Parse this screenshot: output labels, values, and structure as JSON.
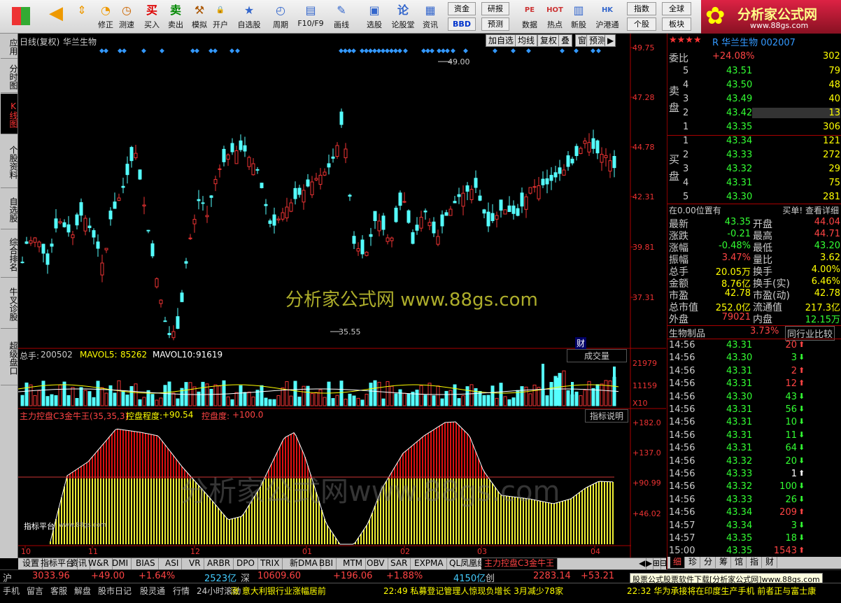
{
  "toolbar": {
    "buttons": [
      "修正",
      "测速",
      "买入",
      "卖出",
      "模拟",
      "开户",
      "自选股",
      "周期",
      "F10/F9",
      "画线",
      "选股",
      "论股堂",
      "资讯",
      "数据",
      "热点",
      "新股",
      "沪港通"
    ],
    "right1": [
      "资金",
      "研报",
      "指数",
      "全球"
    ],
    "right2": [
      "BBD",
      "预测",
      "个股",
      "板块"
    ],
    "logo": "分析家公式网",
    "logo_url": "www.88gs.com"
  },
  "sidebar": [
    "应用",
    "分时图",
    "K线图",
    "个股资料",
    "自选股",
    "综合排名",
    "牛叉诊股",
    "超级盘口"
  ],
  "chart": {
    "title": "日线(复权)",
    "stock": "华兰生物",
    "buttons": [
      "加自选",
      "均线",
      "复权",
      "叠",
      "窗",
      "预测"
    ],
    "price_ticks": [
      "49.75",
      "47.28",
      "44.78",
      "42.31",
      "39.81",
      "37.31"
    ],
    "high_label": "49.00",
    "low_label": "35.55",
    "fin_marker": "财",
    "vol_header": {
      "total_label": "总手:",
      "total": "200502",
      "ma5_label": "MAVOL5:",
      "ma5": "85262",
      "ma10_label": "MAVOL10:",
      "ma10": "91619",
      "select": "成交量"
    },
    "vol_ticks": [
      "21979",
      "11159",
      "X10"
    ],
    "ind_header": {
      "name": "主力控盘C3金牛王(35,35,3)",
      "deg_label": "控盘程度:",
      "deg": "+90.54",
      "ctl_label": "控盘度:",
      "ctl": "+100.0",
      "help": "指标说明"
    },
    "ind_ticks": [
      "+182.0",
      "+137.0",
      "+90.99",
      "+46.02"
    ],
    "ind_note": "指标平台",
    "ind_note2": "www.88gs.com",
    "x_ticks": [
      "10",
      "11",
      "12",
      "01",
      "02",
      "03",
      "04"
    ],
    "watermark1": "分析家公式网 www.88gs.com",
    "watermark2": "分析家公式网www.88gs.com"
  },
  "tabs": [
    "设置",
    "指标平台",
    "资讯",
    "W&R",
    "DMI",
    "BIAS",
    "ASI",
    "VR",
    "ARBR",
    "DPO",
    "TRIX",
    "新DMA",
    "BBI",
    "MTM",
    "OBV",
    "SAR",
    "EXPMA",
    "QL凤凰线",
    "主力控盘C3金牛王"
  ],
  "rpanel": {
    "stars": "★★★★",
    "code": "R 华兰生物 002007",
    "webi_label": "委比",
    "webi": "+24.08%",
    "webi_v": "302",
    "sell": [
      [
        "5",
        "43.51",
        "79"
      ],
      [
        "4",
        "43.50",
        "48"
      ],
      [
        "3",
        "43.49",
        "40"
      ],
      [
        "2",
        "43.42",
        "13"
      ],
      [
        "1",
        "43.35",
        "306"
      ]
    ],
    "buy": [
      [
        "1",
        "43.34",
        "121"
      ],
      [
        "2",
        "43.33",
        "272"
      ],
      [
        "3",
        "43.32",
        "29"
      ],
      [
        "4",
        "43.31",
        "75"
      ],
      [
        "5",
        "43.30",
        "281"
      ]
    ],
    "sell_label": "卖盘",
    "buy_label": "买盘",
    "pos_text": "在0.00位置有",
    "pos_link": "买单! 查看详细",
    "stats": [
      [
        "最新",
        "43.35",
        "开盘",
        "44.04"
      ],
      [
        "涨跌",
        "-0.21",
        "最高",
        "44.71"
      ],
      [
        "涨幅",
        "-0.48%",
        "最低",
        "43.20"
      ],
      [
        "振幅",
        "3.47%",
        "量比",
        "3.62"
      ],
      [
        "总手",
        "20.05万",
        "换手",
        "4.00%"
      ],
      [
        "金额",
        "8.76亿",
        "换手(实)",
        "6.46%"
      ],
      [
        "市盈",
        "42.78",
        "市盈(动)",
        "42.78"
      ],
      [
        "总市值",
        "252.0亿",
        "流通值",
        "217.3亿"
      ],
      [
        "外盘",
        "79021",
        "内盘",
        "12.15万"
      ]
    ],
    "sector": "生物制品",
    "sector_pct": "3.73%",
    "sector_btn": "同行业比较",
    "ticks": [
      [
        "14:56",
        "43.31",
        "20",
        "up"
      ],
      [
        "14:56",
        "43.30",
        "3",
        "dn"
      ],
      [
        "14:56",
        "43.31",
        "2",
        "up"
      ],
      [
        "14:56",
        "43.31",
        "12",
        "up"
      ],
      [
        "14:56",
        "43.30",
        "43",
        "dn"
      ],
      [
        "14:56",
        "43.31",
        "56",
        "dn"
      ],
      [
        "14:56",
        "43.31",
        "10",
        "dn"
      ],
      [
        "14:56",
        "43.31",
        "11",
        "dn"
      ],
      [
        "14:56",
        "43.31",
        "64",
        "dn"
      ],
      [
        "14:56",
        "43.32",
        "20",
        "dn"
      ],
      [
        "14:56",
        "43.33",
        "1",
        "wh"
      ],
      [
        "14:56",
        "43.32",
        "100",
        "dn"
      ],
      [
        "14:56",
        "43.33",
        "26",
        "dn"
      ],
      [
        "14:56",
        "43.34",
        "209",
        "up"
      ],
      [
        "14:57",
        "43.34",
        "3",
        "dn"
      ],
      [
        "14:57",
        "43.35",
        "18",
        "dn"
      ],
      [
        "15:00",
        "43.35",
        "1543",
        "up"
      ]
    ],
    "bottom_tabs": [
      "细",
      "珍",
      "分",
      "筹",
      "馆",
      "指",
      "财"
    ]
  },
  "quotes": {
    "sh": "沪",
    "sh_v": "3033.96",
    "sh_c": "+49.00",
    "sh_p": "+1.64%",
    "sh_a": "2523亿",
    "sz": "深",
    "sz_v": "10609.60",
    "sz_c": "+196.06",
    "sz_p": "+1.88%",
    "sz_a": "4150亿",
    "cy": "创",
    "cy_v": "2283.14",
    "cy_c": "+53.21"
  },
  "bottom": {
    "items": [
      "手机",
      "留言",
      "客服",
      "解盘",
      "股市日记",
      "股灵通",
      "行情",
      "24小时滚动"
    ],
    "news1": "涨 意大利银行业涨幅居前",
    "news2": "22:49 私募登记管理人惊现负增长 3月减少78家",
    "news3": "22:32 华为承接将在印度生产手机 前者正与富士康",
    "tip": "股票公式股票软件下载[分析家公式网]www.88gs.com"
  }
}
